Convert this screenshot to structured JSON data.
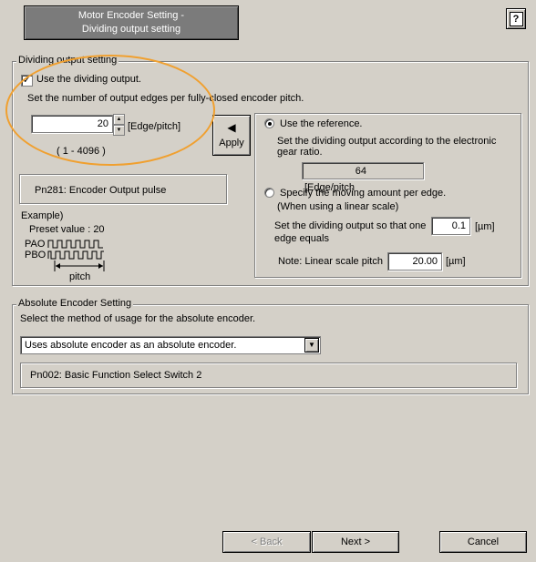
{
  "header": {
    "title_line1": "Motor Encoder Setting -",
    "title_line2": "Dividing output setting",
    "help_label": "?"
  },
  "dividing": {
    "legend": "Dividing output setting",
    "use_label": "Use the dividing output.",
    "use_checked": true,
    "instruction": "Set the number of output edges per fully-closed encoder pitch.",
    "value": "20",
    "unit": "[Edge/pitch]",
    "range": "( 1 - 4096 )",
    "param_label": "Pn281: Encoder Output pulse",
    "example_title": "Example)",
    "example_preset": "Preset value : 20",
    "pao_label": "PAO",
    "pbo_label": "PBO",
    "pitch_label": "pitch",
    "apply_label": "Apply"
  },
  "reference": {
    "radio_label": "Use the reference.",
    "desc_line1": "Set the dividing output according to the electronic",
    "desc_line2": "gear ratio.",
    "value": "64",
    "unit": "[Edge/pitch"
  },
  "moving": {
    "radio_label": "Specify the moving amount per edge.",
    "radio_sub": "(When using a linear scale)",
    "edge_line1": "Set the dividing output so that one",
    "edge_line2": "edge equals",
    "edge_value": "0.1",
    "edge_unit": "[µm]",
    "pitch_label": "Note: Linear scale pitch",
    "pitch_value": "20.00",
    "pitch_unit": "[µm]"
  },
  "absolute": {
    "legend": "Absolute Encoder Setting",
    "instruction": "Select the method of usage for the absolute encoder.",
    "selected": "Uses absolute encoder as an absolute encoder.",
    "param_label": "Pn002: Basic Function Select Switch 2"
  },
  "footer": {
    "back_label": "< Back",
    "next_label": "Next >",
    "cancel_label": "Cancel"
  }
}
